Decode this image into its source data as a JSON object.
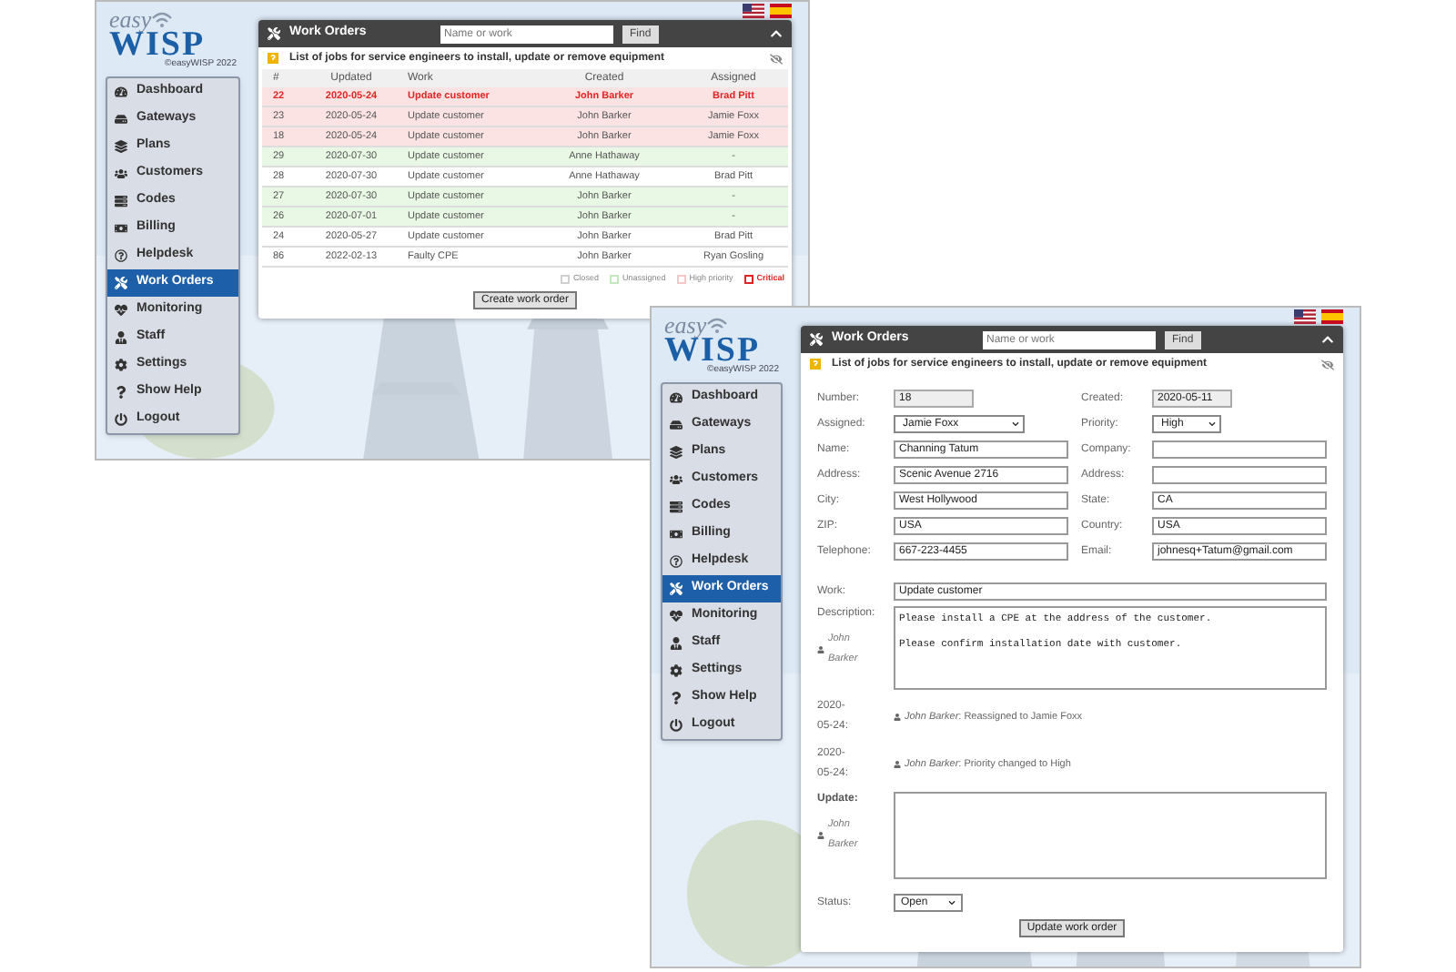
{
  "screenshots": [
    {
      "kind": "list",
      "logo": {
        "top": "easy",
        "main": "WISP",
        "tagline": "©easyWISP 2022"
      },
      "menu": [
        {
          "label": "Dashboard",
          "selected": false
        },
        {
          "label": "Gateways",
          "selected": false
        },
        {
          "label": "Plans",
          "selected": false
        },
        {
          "label": "Customers",
          "selected": false
        },
        {
          "label": "Codes",
          "selected": false
        },
        {
          "label": "Billing",
          "selected": false
        },
        {
          "label": "Helpdesk",
          "selected": false
        },
        {
          "label": "Work Orders",
          "selected": true
        },
        {
          "label": "Monitoring",
          "selected": false
        },
        {
          "label": "Staff",
          "selected": false
        },
        {
          "label": "Settings",
          "selected": false
        },
        {
          "label": "Show Help",
          "selected": false
        },
        {
          "label": "Logout",
          "selected": false
        }
      ],
      "panel": {
        "title": "Work Orders",
        "search_placeholder": "Name or work",
        "find_button": "Find",
        "subtitle": "List of jobs for service engineers to install, update or remove equipment",
        "table": {
          "columns": [
            "#",
            "Updated",
            "Work",
            "Created",
            "Assigned"
          ],
          "rows": [
            {
              "kind": "critical",
              "cells": [
                "22",
                "2020-05-24",
                "Update customer",
                "John Barker",
                "Brad Pitt"
              ]
            },
            {
              "kind": "high",
              "cells": [
                "23",
                "2020-05-24",
                "Update customer",
                "John Barker",
                "Jamie Foxx"
              ]
            },
            {
              "kind": "high",
              "cells": [
                "18",
                "2020-05-24",
                "Update customer",
                "John Barker",
                "Jamie Foxx"
              ]
            },
            {
              "kind": "unassigned",
              "cells": [
                "29",
                "2020-07-30",
                "Update customer",
                "Anne Hathaway",
                "-"
              ]
            },
            {
              "kind": "open",
              "cells": [
                "28",
                "2020-07-30",
                "Update customer",
                "Anne Hathaway",
                "Brad Pitt"
              ]
            },
            {
              "kind": "unassigned",
              "cells": [
                "27",
                "2020-07-30",
                "Update customer",
                "John Barker",
                "-"
              ]
            },
            {
              "kind": "unassigned",
              "cells": [
                "26",
                "2020-07-01",
                "Update customer",
                "John Barker",
                "-"
              ]
            },
            {
              "kind": "open",
              "cells": [
                "24",
                "2020-05-27",
                "Update customer",
                "John Barker",
                "Brad Pitt"
              ]
            },
            {
              "kind": "open",
              "cells": [
                "86",
                "2022-02-13",
                "Faulty CPE",
                "John Barker",
                "Ryan Gosling"
              ]
            }
          ]
        },
        "legend": [
          {
            "label": "Closed",
            "color": "#d0d0d0",
            "highlight": false
          },
          {
            "label": "Unassigned",
            "color": "#c6e8c0",
            "highlight": false
          },
          {
            "label": "High priority",
            "color": "#f4c8c8",
            "highlight": false
          },
          {
            "label": "Critical",
            "color": "#e02424",
            "highlight": true
          }
        ],
        "action_button": "Create work order"
      }
    },
    {
      "kind": "form",
      "logo": {
        "top": "easy",
        "main": "WISP",
        "tagline": "©easyWISP 2022"
      },
      "menu": [
        {
          "label": "Dashboard",
          "selected": false
        },
        {
          "label": "Gateways",
          "selected": false
        },
        {
          "label": "Plans",
          "selected": false
        },
        {
          "label": "Customers",
          "selected": false
        },
        {
          "label": "Codes",
          "selected": false
        },
        {
          "label": "Billing",
          "selected": false
        },
        {
          "label": "Helpdesk",
          "selected": false
        },
        {
          "label": "Work Orders",
          "selected": true
        },
        {
          "label": "Monitoring",
          "selected": false
        },
        {
          "label": "Staff",
          "selected": false
        },
        {
          "label": "Settings",
          "selected": false
        },
        {
          "label": "Show Help",
          "selected": false
        },
        {
          "label": "Logout",
          "selected": false
        }
      ],
      "panel": {
        "title": "Work Orders",
        "search_placeholder": "Name or work",
        "find_button": "Find",
        "subtitle": "List of jobs for service engineers to install, update or remove equipment",
        "fields": [
          {
            "label": "Number:",
            "value": "18",
            "kind": "readonly"
          },
          {
            "label": "Created:",
            "value": "2020-05-11",
            "kind": "readonly"
          },
          {
            "label": "Assigned:",
            "value": "Jamie Foxx",
            "kind": "select"
          },
          {
            "label": "Priority:",
            "value": "High",
            "kind": "select"
          },
          {
            "label": "Name:",
            "value": "Channing Tatum",
            "kind": "text"
          },
          {
            "label": "Company:",
            "kind": "text"
          },
          {
            "label": "Address:",
            "value": "Scenic Avenue 2716",
            "kind": "text"
          },
          {
            "label": "Address:",
            "kind": "text"
          },
          {
            "label": "City:",
            "value": "West Hollywood",
            "kind": "text"
          },
          {
            "label": "State:",
            "value": "CA",
            "kind": "text"
          },
          {
            "label": "ZIP:",
            "value": "USA",
            "kind": "text"
          },
          {
            "label": "Country:",
            "value": "USA",
            "kind": "text"
          },
          {
            "label": "Telephone:",
            "value": "667-223-4455",
            "kind": "text"
          },
          {
            "label": "Email:",
            "value": "johnesq+Tatum@gmail.com",
            "kind": "text"
          }
        ],
        "work": {
          "label": "Work:",
          "value": "Update customer"
        },
        "description": {
          "label": "Description:",
          "author": "John Barker",
          "value": "Please install a CPE at the address of the customer.\n\nPlease confirm installation date with customer."
        },
        "history": [
          {
            "date": "2020-05-24:",
            "text": "*John Barker*: Reassigned to Jamie Foxx"
          },
          {
            "date": "2020-05-24:",
            "text": "*John Barker*: Priority changed to High"
          }
        ],
        "update": {
          "label": "Update:",
          "author": "John Barker"
        },
        "status": {
          "label": "Status:",
          "value": "Open"
        },
        "action_button": "Update work order"
      }
    }
  ]
}
